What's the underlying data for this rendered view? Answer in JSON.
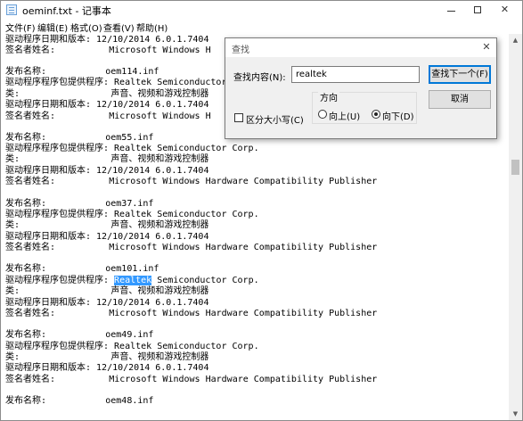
{
  "window": {
    "title": "oeminf.txt - 记事本",
    "buttons": {
      "minimize": "minimize",
      "maximize": "maximize",
      "close": "✕"
    }
  },
  "menu": [
    "文件(F)",
    "编辑(E)",
    "格式(O)",
    "查看(V)",
    "帮助(H)"
  ],
  "lines": [
    "驱动程序日期和版本: 12/10/2014 6.0.1.7404",
    "签名者姓名:          Microsoft Windows H",
    "",
    "发布名称:           oem114.inf",
    "驱动程序程序包提供程序: Realtek Semiconductor",
    "类:                 声音、视频和游戏控制器",
    "驱动程序日期和版本: 12/10/2014 6.0.1.7404",
    "签名者姓名:          Microsoft Windows H",
    "",
    "发布名称:           oem55.inf",
    "驱动程序程序包提供程序: Realtek Semiconductor Corp.",
    "类:                 声音、视频和游戏控制器",
    "驱动程序日期和版本: 12/10/2014 6.0.1.7404",
    "签名者姓名:          Microsoft Windows Hardware Compatibility Publisher",
    "",
    "发布名称:           oem37.inf",
    "驱动程序程序包提供程序: Realtek Semiconductor Corp.",
    "类:                 声音、视频和游戏控制器",
    "驱动程序日期和版本: 12/10/2014 6.0.1.7404",
    "签名者姓名:          Microsoft Windows Hardware Compatibility Publisher",
    "",
    "发布名称:           oem101.inf",
    "驱动程序程序包提供程序: ",
    "类:                 声音、视频和游戏控制器",
    "驱动程序日期和版本: 12/10/2014 6.0.1.7404",
    "签名者姓名:          Microsoft Windows Hardware Compatibility Publisher",
    "",
    "发布名称:           oem49.inf",
    "驱动程序程序包提供程序: Realtek Semiconductor Corp.",
    "类:                 声音、视频和游戏控制器",
    "驱动程序日期和版本: 12/10/2014 6.0.1.7404",
    "签名者姓名:          Microsoft Windows Hardware Compatibility Publisher",
    "",
    "发布名称:           oem48.inf"
  ],
  "selection": {
    "prefix": "驱动程序程序包提供程序: ",
    "selected": "Realtek",
    "suffix": " Semiconductor Corp."
  },
  "find_dialog": {
    "title": "查找",
    "close": "✕",
    "find_label": "查找内容(N):",
    "find_value": "realtek",
    "find_next": "查找下一个(F)",
    "cancel": "取消",
    "match_case": "区分大小写(C)",
    "direction_title": "方向",
    "up": "向上(U)",
    "down": "向下(D)",
    "direction_selected": "down"
  }
}
